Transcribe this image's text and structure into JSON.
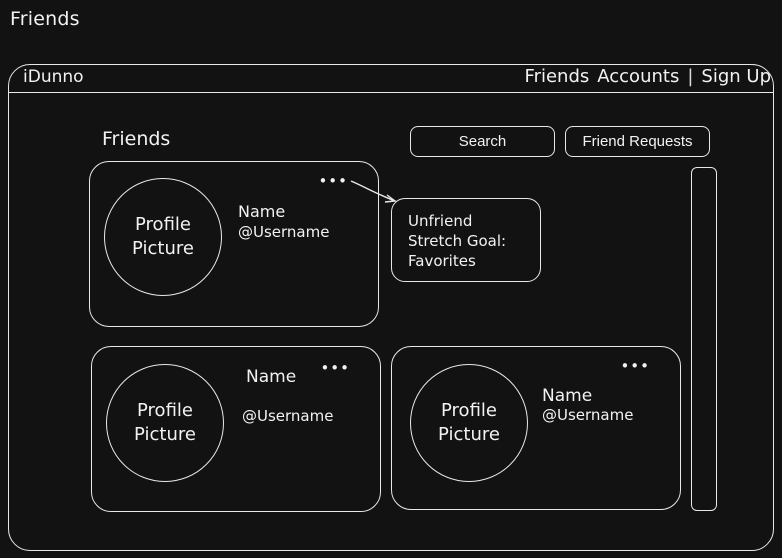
{
  "page": {
    "title": "Friends"
  },
  "topbar": {
    "brand": "iDunno",
    "nav": {
      "friends": "Friends",
      "accounts": "Accounts",
      "separator": "|",
      "signup": "Sign Up"
    }
  },
  "main": {
    "title": "Friends",
    "search_label": "Search",
    "friend_requests_label": "Friend Requests"
  },
  "cards": [
    {
      "avatar_line1": "Profile",
      "avatar_line2": "Picture",
      "name": "Name",
      "username": "@Username",
      "more": "•••"
    },
    {
      "avatar_line1": "Profile",
      "avatar_line2": "Picture",
      "name": "Name",
      "username": "@Username",
      "more": "•••"
    },
    {
      "avatar_line1": "Profile",
      "avatar_line2": "Picture",
      "name": "Name",
      "username": "@Username",
      "more": "•••"
    }
  ],
  "context_menu": {
    "items": [
      "Unfriend",
      "Stretch Goal:",
      "Favorites"
    ]
  },
  "icons": {
    "more": "more-horizontal-icon",
    "arrow": "arrow-right-icon"
  }
}
